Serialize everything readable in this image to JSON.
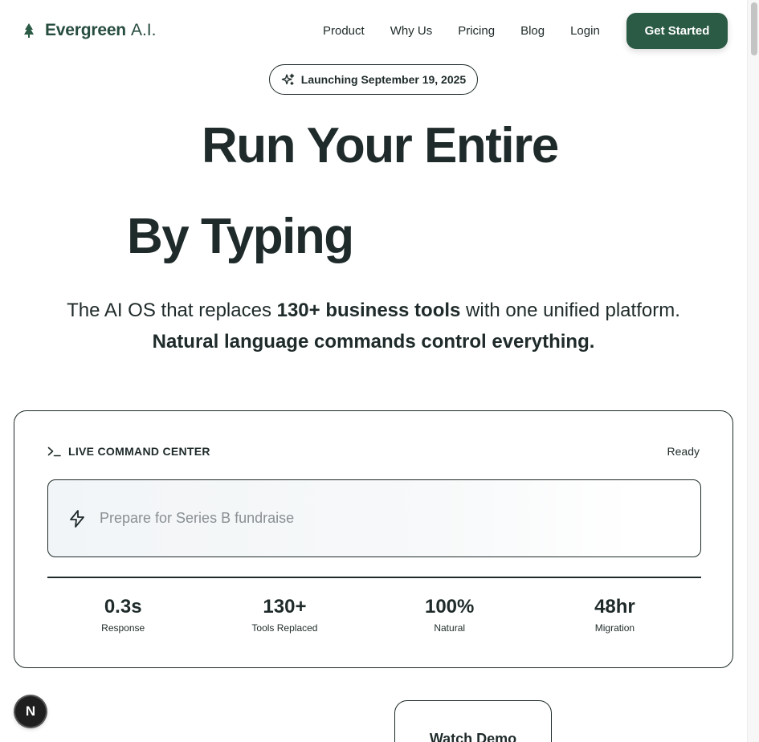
{
  "nav": {
    "logo_name": "Evergreen",
    "logo_suffix": "A.I.",
    "links": [
      "Product",
      "Why Us",
      "Pricing",
      "Blog",
      "Login"
    ],
    "cta": "Get Started"
  },
  "launch_pill": "Launching September 19, 2025",
  "hero": {
    "line1": "Run Your Entire",
    "line2": "By Typing",
    "sub1_pre": "The AI OS that replaces ",
    "sub1_bold": "130+ business tools",
    "sub1_post": " with one unified platform.",
    "sub2": "Natural language commands control everything."
  },
  "command_center": {
    "title": "LIVE COMMAND CENTER",
    "status": "Ready",
    "placeholder": "Prepare for Series B fundraise",
    "stats": [
      {
        "value": "0.3s",
        "label": "Response"
      },
      {
        "value": "130+",
        "label": "Tools Replaced"
      },
      {
        "value": "100%",
        "label": "Natural"
      },
      {
        "value": "48hr",
        "label": "Migration"
      }
    ]
  },
  "badge_letter": "N",
  "watch_demo": "Watch Demo",
  "colors": {
    "brand_green": "#2b5a45",
    "text": "#1f2a2a"
  },
  "icons": {
    "logo": "tree-icon",
    "pill": "sparkles-icon",
    "terminal": "terminal-icon",
    "input": "bolt-icon"
  }
}
